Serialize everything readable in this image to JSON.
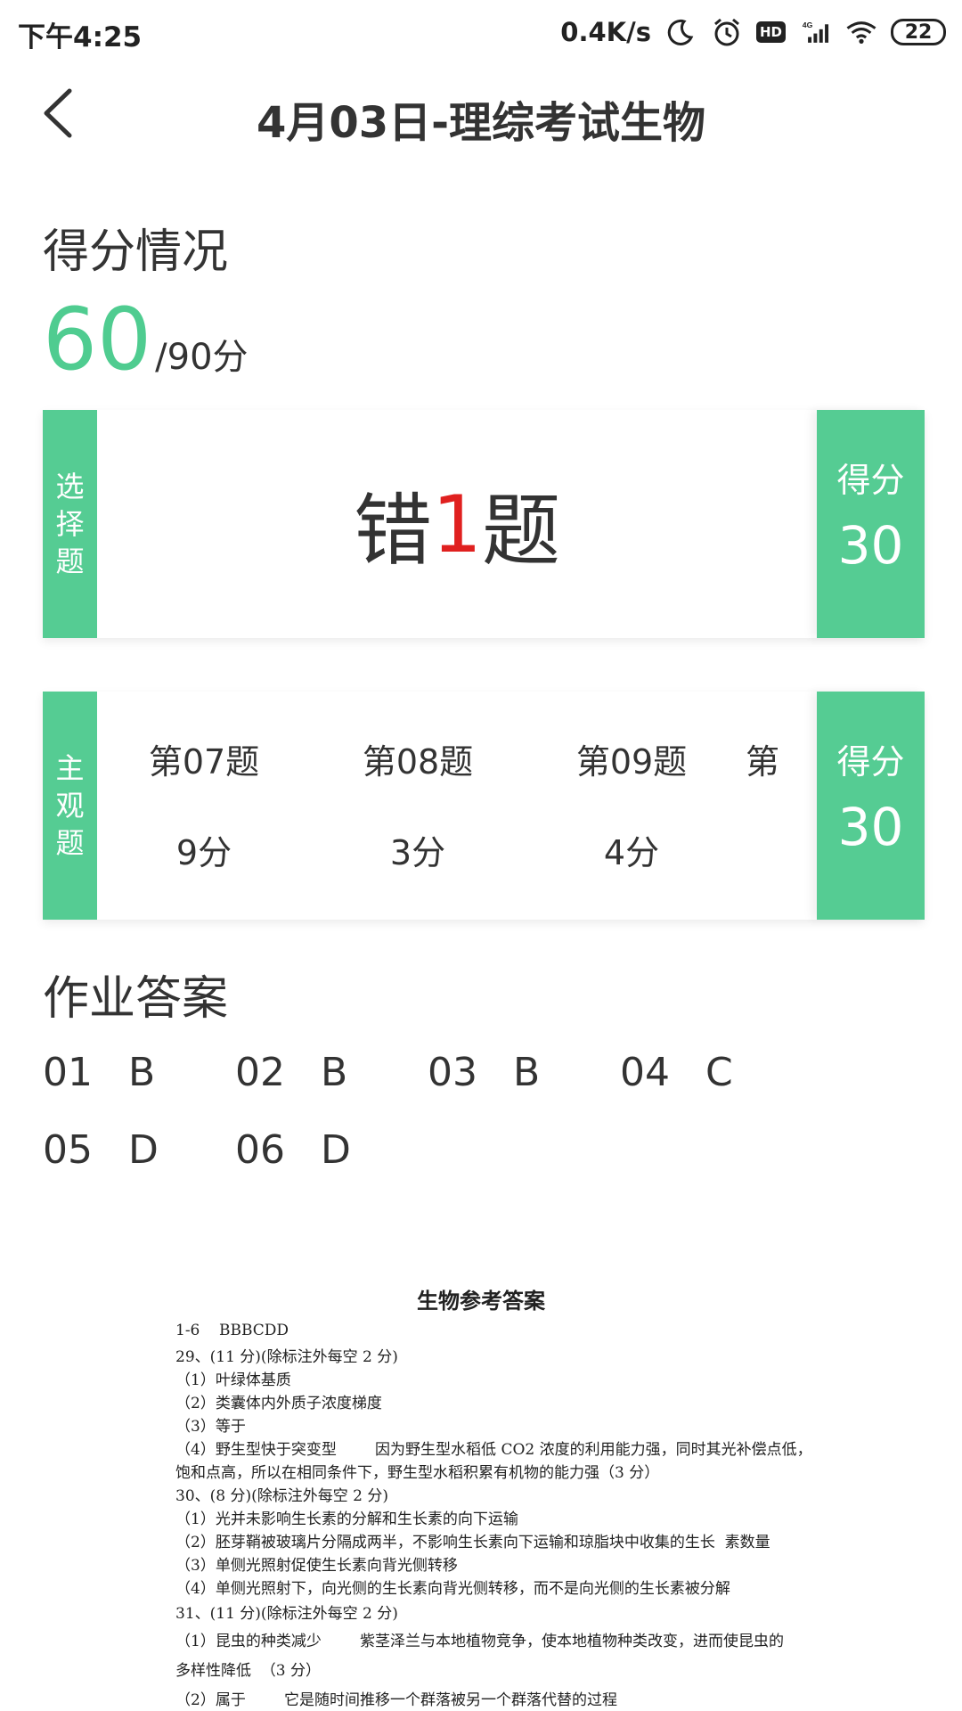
{
  "status_bar": {
    "time": "下午4:25",
    "speed": "0.4K/s",
    "hd": "HD",
    "battery": "22"
  },
  "header": {
    "title": "4月03日-理综考试生物"
  },
  "score_section": {
    "title": "得分情况",
    "score": "60",
    "total": "/90分"
  },
  "choice_card": {
    "label_chars": [
      "选",
      "择",
      "题"
    ],
    "wrong_prefix": "错",
    "wrong_count": "1",
    "wrong_suffix": "题",
    "score_label": "得分",
    "score_value": "30"
  },
  "subjective_card": {
    "label_chars": [
      "主",
      "观",
      "题"
    ],
    "items": [
      {
        "question": "第07题",
        "score": "9分"
      },
      {
        "question": "第08题",
        "score": "3分"
      },
      {
        "question": "第09题",
        "score": "4分"
      },
      {
        "question": "第",
        "score": ""
      }
    ],
    "score_label": "得分",
    "score_value": "30"
  },
  "answers_section": {
    "title": "作业答案",
    "items": [
      {
        "num": "01",
        "ans": "B"
      },
      {
        "num": "02",
        "ans": "B"
      },
      {
        "num": "03",
        "ans": "B"
      },
      {
        "num": "04",
        "ans": "C"
      },
      {
        "num": "05",
        "ans": "D"
      },
      {
        "num": "06",
        "ans": "D"
      }
    ]
  },
  "answer_doc": {
    "title": "生物参考答案",
    "lines": [
      "1-6    BBBCDD",
      "29、(11 分)(除标注外每空 2 分)",
      "（1）叶绿体基质",
      "（2）类囊体内外质子浓度梯度",
      "（3）等于",
      "（4）野生型快于突变型        因为野生型水稻低 CO2 浓度的利用能力强，同时其光补偿点低，",
      "饱和点高，所以在相同条件下，野生型水稻积累有机物的能力强（3 分）",
      "30、(8 分)(除标注外每空 2 分)",
      "（1）光并未影响生长素的分解和生长素的向下运输",
      "（2）胚芽鞘被玻璃片分隔成两半，不影响生长素向下运输和琼脂块中收集的生长  素数量",
      "（3）单侧光照射促使生长素向背光侧转移",
      "（4）单侧光照射下，向光侧的生长素向背光侧转移，而不是向光侧的生长素被分解",
      "31、(11 分)(除标注外每空 2 分)",
      "（1）昆虫的种类减少        紫茎泽兰与本地植物竞争，使本地植物种类改变，进而使昆虫的",
      "多样性降低  （3 分）",
      "（2）属于        它是随时间推移一个群落被另一个群落代替的过程"
    ]
  }
}
